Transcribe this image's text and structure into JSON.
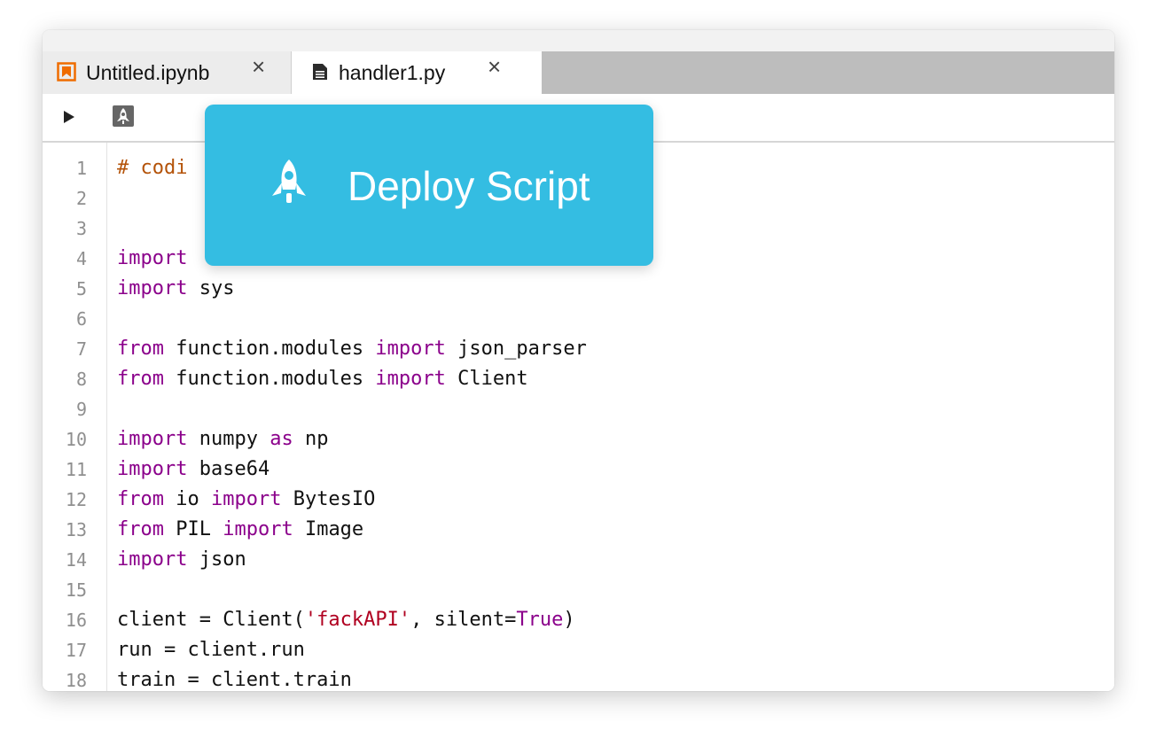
{
  "tabs": [
    {
      "label": "Untitled.ipynb",
      "icon": "notebook-icon",
      "active": false
    },
    {
      "label": "handler1.py",
      "icon": "file-icon",
      "active": true
    }
  ],
  "toolbar": {
    "run_icon": "play-icon",
    "deploy_icon": "rocket-icon"
  },
  "tooltip": {
    "label": "Deploy Script",
    "icon": "rocket-icon",
    "color": "#34bde2"
  },
  "colors": {
    "keyword": "#8b008b",
    "comment": "#b45309",
    "string": "#b00020",
    "notebook": "#ef6c00"
  },
  "editor": {
    "line_numbers": [
      "1",
      "2",
      "3",
      "4",
      "5",
      "6",
      "7",
      "8",
      "9",
      "10",
      "11",
      "12",
      "13",
      "14",
      "15",
      "16",
      "17",
      "18"
    ],
    "lines": {
      "l1": {
        "c": "# codi"
      },
      "l4": {
        "k": "import"
      },
      "l5": {
        "k": "import",
        "t": " sys"
      },
      "l7": {
        "k1": "from",
        "t1": " function.modules ",
        "k2": "import",
        "t2": " json_parser"
      },
      "l8": {
        "k1": "from",
        "t1": " function.modules ",
        "k2": "import",
        "t2": " Client"
      },
      "l10": {
        "k1": "import",
        "t1": " numpy ",
        "k2": "as",
        "t2": " np"
      },
      "l11": {
        "k": "import",
        "t": " base64"
      },
      "l12": {
        "k1": "from",
        "t1": " io ",
        "k2": "import",
        "t2": " BytesIO"
      },
      "l13": {
        "k1": "from",
        "t1": " PIL ",
        "k2": "import",
        "t2": " Image"
      },
      "l14": {
        "k": "import",
        "t": " json"
      },
      "l16": {
        "t1": "client = Client(",
        "s": "'fackAPI'",
        "t2": ", silent=",
        "k": "True",
        "t3": ")"
      },
      "l17": {
        "t": "run = client.run"
      },
      "l18": {
        "t": "train = client.train"
      }
    }
  }
}
